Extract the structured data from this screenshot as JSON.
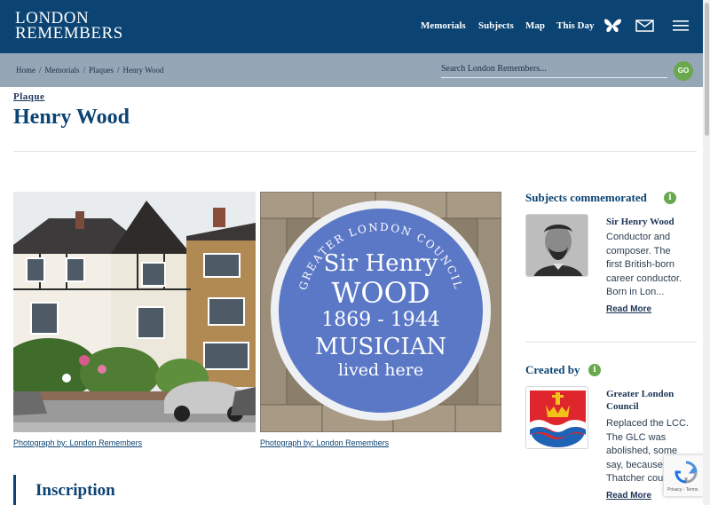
{
  "header": {
    "logo_line1": "LONDON",
    "logo_line2": "REMEMBERS",
    "nav": [
      "Memorials",
      "Subjects",
      "Map",
      "This Day"
    ],
    "icons": [
      "butterfly-icon",
      "mail-icon",
      "menu-icon"
    ]
  },
  "breadcrumb": {
    "items": [
      "Home",
      "Memorials",
      "Plaques",
      "Henry Wood"
    ],
    "separator": "/"
  },
  "search": {
    "placeholder": "Search London Remembers...",
    "go_label": "GO"
  },
  "page": {
    "kind": "Plaque",
    "title": "Henry Wood"
  },
  "photos": [
    {
      "caption": "Photograph by: London Remembers"
    },
    {
      "caption": "Photograph by: London Remembers"
    }
  ],
  "plaque": {
    "ring": "GREATER LONDON COUNCIL",
    "line1": "Sir Henry",
    "line2": "WOOD",
    "line3": "1869 - 1944",
    "line4": "MUSICIAN",
    "line5": "lived here"
  },
  "inscription": {
    "heading": "Inscription"
  },
  "sidebar": {
    "subjects_heading": "Subjects commemorated",
    "subject": {
      "name": "Sir Henry Wood",
      "desc1": "Conductor and",
      "desc2": "composer.  The",
      "desc3": "first British-born",
      "desc4": "career conductor.",
      "desc5": "Born in Lon...",
      "read_more": "Read More"
    },
    "created_heading": "Created by",
    "creator": {
      "name1": "Greater London",
      "name2": "Council",
      "desc1": "Replaced the LCC.",
      "desc2": "The GLC was",
      "desc3": "abolished, some",
      "desc4": "say, because",
      "desc5": "Thatcher cou...",
      "read_more": "Read More"
    },
    "info_glyph": "i"
  },
  "colors": {
    "header": "#0b4372",
    "crumbbar": "#95a6b6",
    "accent_green": "#6aa84f",
    "plaque_blue": "#5b78c7"
  },
  "recaptcha": {
    "text": "Privacy - Terms"
  }
}
